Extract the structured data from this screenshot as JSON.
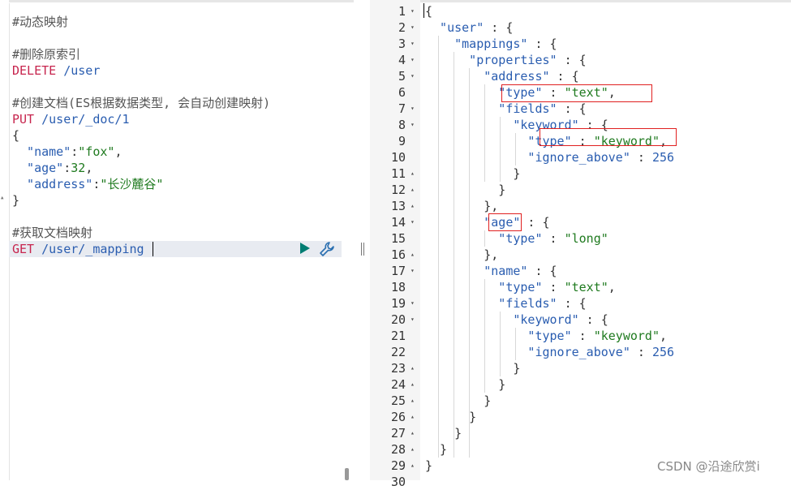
{
  "left_editor": {
    "lines": [
      {
        "parts": [
          {
            "t": "#动态映射",
            "c": "comment"
          }
        ]
      },
      {
        "parts": []
      },
      {
        "parts": [
          {
            "t": "#删除原索引",
            "c": "comment"
          }
        ]
      },
      {
        "parts": [
          {
            "t": "DELETE",
            "c": "method"
          },
          {
            "t": " /user",
            "c": "path"
          }
        ]
      },
      {
        "parts": []
      },
      {
        "parts": [
          {
            "t": "#创建文档(ES根据数据类型, 会自动创建映射)",
            "c": "comment"
          }
        ]
      },
      {
        "parts": [
          {
            "t": "PUT",
            "c": "method"
          },
          {
            "t": " /user/_doc/1",
            "c": "path"
          }
        ]
      },
      {
        "parts": [
          {
            "t": "{",
            "c": ""
          }
        ]
      },
      {
        "parts": [
          {
            "t": "  \"name\"",
            "c": "key"
          },
          {
            "t": ":",
            "c": ""
          },
          {
            "t": "\"fox\"",
            "c": "str"
          },
          {
            "t": ",",
            "c": ""
          }
        ]
      },
      {
        "parts": [
          {
            "t": "  \"age\"",
            "c": "key"
          },
          {
            "t": ":",
            "c": ""
          },
          {
            "t": "32",
            "c": "num"
          },
          {
            "t": ",",
            "c": ""
          }
        ]
      },
      {
        "parts": [
          {
            "t": "  \"address\"",
            "c": "key"
          },
          {
            "t": ":",
            "c": ""
          },
          {
            "t": "\"长沙麓谷\"",
            "c": "str"
          }
        ]
      },
      {
        "parts": [
          {
            "t": "}",
            "c": ""
          }
        ]
      },
      {
        "parts": []
      },
      {
        "parts": [
          {
            "t": "#获取文档映射",
            "c": "comment"
          }
        ]
      },
      {
        "parts": [
          {
            "t": "GET",
            "c": "method"
          },
          {
            "t": " /user/_mapping",
            "c": "path"
          }
        ]
      }
    ]
  },
  "right_editor": {
    "lines": [
      {
        "n": "1",
        "fold": "▾",
        "parts": [
          {
            "t": "{",
            "c": ""
          }
        ]
      },
      {
        "n": "2",
        "fold": "▾",
        "parts": [
          {
            "t": "  \"user\"",
            "c": "key"
          },
          {
            "t": " : {",
            "c": ""
          }
        ]
      },
      {
        "n": "3",
        "fold": "▾",
        "parts": [
          {
            "t": "    \"mappings\"",
            "c": "key"
          },
          {
            "t": " : {",
            "c": ""
          }
        ]
      },
      {
        "n": "4",
        "fold": "▾",
        "parts": [
          {
            "t": "      \"properties\"",
            "c": "key"
          },
          {
            "t": " : {",
            "c": ""
          }
        ]
      },
      {
        "n": "5",
        "fold": "▾",
        "parts": [
          {
            "t": "        \"address\"",
            "c": "key"
          },
          {
            "t": " : {",
            "c": ""
          }
        ]
      },
      {
        "n": "6",
        "fold": "",
        "parts": [
          {
            "t": "          \"type\"",
            "c": "key"
          },
          {
            "t": " : ",
            "c": ""
          },
          {
            "t": "\"text\"",
            "c": "str"
          },
          {
            "t": ",",
            "c": ""
          }
        ]
      },
      {
        "n": "7",
        "fold": "▾",
        "parts": [
          {
            "t": "          \"fields\"",
            "c": "key"
          },
          {
            "t": " : {",
            "c": ""
          }
        ]
      },
      {
        "n": "8",
        "fold": "▾",
        "parts": [
          {
            "t": "            \"keyword\"",
            "c": "key"
          },
          {
            "t": " : {",
            "c": ""
          }
        ]
      },
      {
        "n": "9",
        "fold": "",
        "parts": [
          {
            "t": "              \"type\"",
            "c": "key"
          },
          {
            "t": " : ",
            "c": ""
          },
          {
            "t": "\"keyword\"",
            "c": "str"
          },
          {
            "t": ",",
            "c": ""
          }
        ]
      },
      {
        "n": "10",
        "fold": "",
        "parts": [
          {
            "t": "              \"ignore_above\"",
            "c": "key"
          },
          {
            "t": " : ",
            "c": ""
          },
          {
            "t": "256",
            "c": "num"
          }
        ]
      },
      {
        "n": "11",
        "fold": "▴",
        "parts": [
          {
            "t": "            }",
            "c": ""
          }
        ]
      },
      {
        "n": "12",
        "fold": "▴",
        "parts": [
          {
            "t": "          }",
            "c": ""
          }
        ]
      },
      {
        "n": "13",
        "fold": "▴",
        "parts": [
          {
            "t": "        },",
            "c": ""
          }
        ]
      },
      {
        "n": "14",
        "fold": "▾",
        "parts": [
          {
            "t": "        \"age\"",
            "c": "key"
          },
          {
            "t": " : {",
            "c": ""
          }
        ]
      },
      {
        "n": "15",
        "fold": "",
        "parts": [
          {
            "t": "          \"type\"",
            "c": "key"
          },
          {
            "t": " : ",
            "c": ""
          },
          {
            "t": "\"long\"",
            "c": "str"
          }
        ]
      },
      {
        "n": "16",
        "fold": "▴",
        "parts": [
          {
            "t": "        },",
            "c": ""
          }
        ]
      },
      {
        "n": "17",
        "fold": "▾",
        "parts": [
          {
            "t": "        \"name\"",
            "c": "key"
          },
          {
            "t": " : {",
            "c": ""
          }
        ]
      },
      {
        "n": "18",
        "fold": "",
        "parts": [
          {
            "t": "          \"type\"",
            "c": "key"
          },
          {
            "t": " : ",
            "c": ""
          },
          {
            "t": "\"text\"",
            "c": "str"
          },
          {
            "t": ",",
            "c": ""
          }
        ]
      },
      {
        "n": "19",
        "fold": "▾",
        "parts": [
          {
            "t": "          \"fields\"",
            "c": "key"
          },
          {
            "t": " : {",
            "c": ""
          }
        ]
      },
      {
        "n": "20",
        "fold": "▾",
        "parts": [
          {
            "t": "            \"keyword\"",
            "c": "key"
          },
          {
            "t": " : {",
            "c": ""
          }
        ]
      },
      {
        "n": "21",
        "fold": "",
        "parts": [
          {
            "t": "              \"type\"",
            "c": "key"
          },
          {
            "t": " : ",
            "c": ""
          },
          {
            "t": "\"keyword\"",
            "c": "str"
          },
          {
            "t": ",",
            "c": ""
          }
        ]
      },
      {
        "n": "22",
        "fold": "",
        "parts": [
          {
            "t": "              \"ignore_above\"",
            "c": "key"
          },
          {
            "t": " : ",
            "c": ""
          },
          {
            "t": "256",
            "c": "num"
          }
        ]
      },
      {
        "n": "23",
        "fold": "▴",
        "parts": [
          {
            "t": "            }",
            "c": ""
          }
        ]
      },
      {
        "n": "24",
        "fold": "▴",
        "parts": [
          {
            "t": "          }",
            "c": ""
          }
        ]
      },
      {
        "n": "25",
        "fold": "▴",
        "parts": [
          {
            "t": "        }",
            "c": ""
          }
        ]
      },
      {
        "n": "26",
        "fold": "▴",
        "parts": [
          {
            "t": "      }",
            "c": ""
          }
        ]
      },
      {
        "n": "27",
        "fold": "▴",
        "parts": [
          {
            "t": "    }",
            "c": ""
          }
        ]
      },
      {
        "n": "28",
        "fold": "▴",
        "parts": [
          {
            "t": "  }",
            "c": ""
          }
        ]
      },
      {
        "n": "29",
        "fold": "▴",
        "parts": [
          {
            "t": "}",
            "c": ""
          }
        ]
      },
      {
        "n": "30",
        "fold": "",
        "parts": []
      }
    ]
  },
  "watermark": "CSDN @沿途欣赏i",
  "colors": {
    "method": "#c7254e",
    "key": "#2a5db0",
    "string": "#1f7a1f",
    "highlight_box": "#e02020",
    "run_button": "#017d73"
  },
  "icons": {
    "run": "play-icon",
    "settings": "wrench-icon"
  }
}
